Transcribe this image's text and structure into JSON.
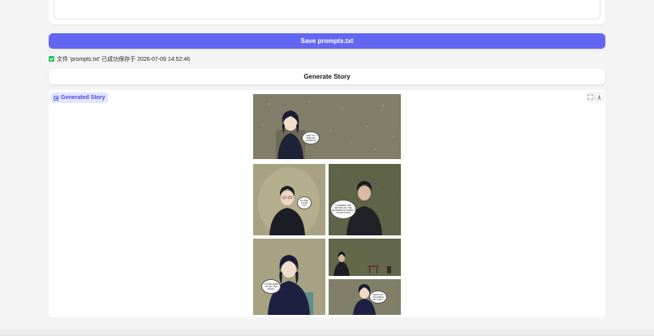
{
  "save_button": {
    "label": "Save prompts.txt"
  },
  "status": {
    "message": "文件 'prompts.txt' 已成功保存于 2026-07-09 14:52:46"
  },
  "generate_button": {
    "label": "Generate Story"
  },
  "output": {
    "label": "Generated Story",
    "tools": [
      "fullscreen-icon",
      "download-icon"
    ],
    "comic_panels": [
      {
        "name": "panel-1",
        "bubble": "ARE YOU FEELING ALRIGHT?"
      },
      {
        "name": "panel-2",
        "bubble": "I'M FINE, THANK YOU"
      },
      {
        "name": "panel-3",
        "bubble": "I LEARNED THE SETTING OF THE BOARDROOM WHEN I STOOD FOUR"
      },
      {
        "name": "panel-4",
        "bubble": "YOU'RE HERE TO GET THE TRUTH"
      },
      {
        "name": "panel-5",
        "bubble": ""
      },
      {
        "name": "panel-6",
        "bubble": "WHAT DO YOU MEAN BY THAT?"
      }
    ]
  },
  "colors": {
    "accent": "#6366f1",
    "label_bg": "#e0e7ff",
    "success": "#22c55e"
  }
}
